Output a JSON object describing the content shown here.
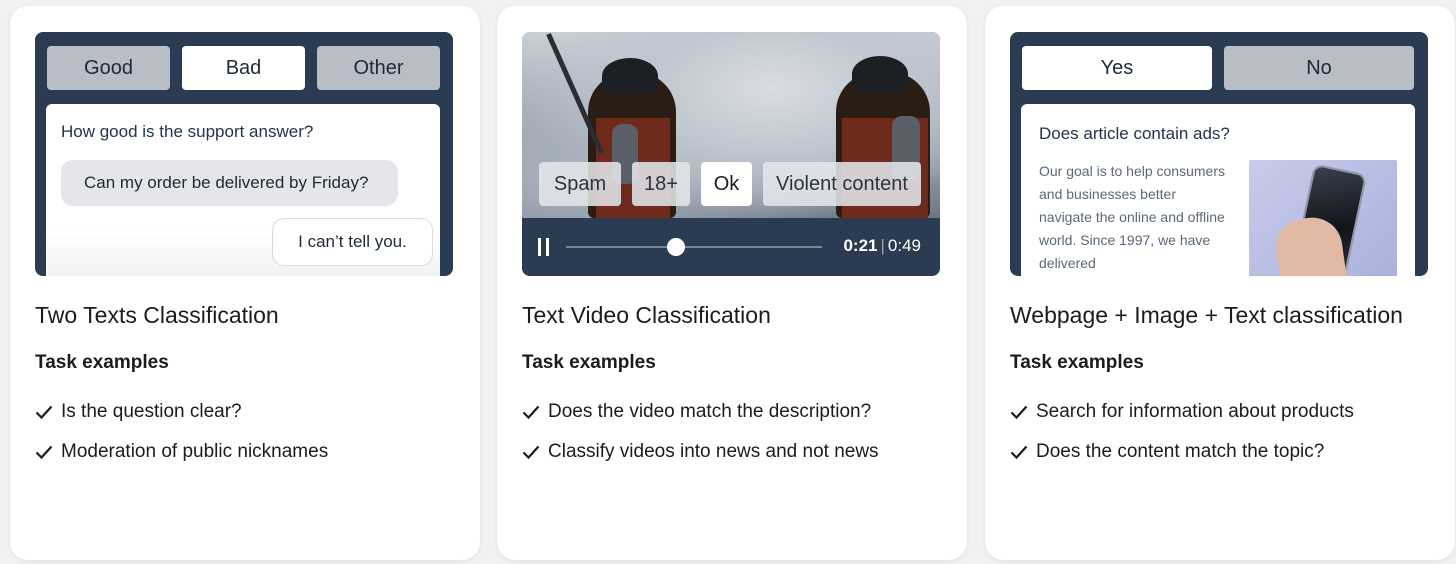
{
  "cards": [
    {
      "title": "Two Texts Classification",
      "task_heading": "Task examples",
      "tasks": [
        "Is the question clear?",
        "Moderation of public nicknames"
      ],
      "preview": {
        "tabs": [
          "Good",
          "Bad",
          "Other"
        ],
        "active_tab": "Bad",
        "question": "How good is the support answer?",
        "message_left": "Can my order be delivered by Friday?",
        "message_right": "I can’t tell you."
      }
    },
    {
      "title": "Text Video Classification",
      "task_heading": "Task examples",
      "tasks": [
        "Does the video match the description?",
        "Classify videos into news and not news"
      ],
      "preview": {
        "tags": [
          "Spam",
          "18+",
          "Ok",
          "Violent content"
        ],
        "active_tag": "Ok",
        "time_current": "0:21",
        "time_separator": "|",
        "time_total": "0:49",
        "progress_fraction": 0.43
      }
    },
    {
      "title": "Webpage + Image + Text classification",
      "task_heading": "Task examples",
      "tasks": [
        "Search for information about products",
        "Does the content match the topic?"
      ],
      "preview": {
        "tabs": [
          "Yes",
          "No"
        ],
        "active_tab": "Yes",
        "question": "Does article contain ads?",
        "body": "Our goal is to help consumers and businesses better navigate the online and offline world. Since 1997, we have delivered"
      }
    }
  ],
  "icons": {
    "check": "check-icon",
    "pause": "pause-icon"
  },
  "colors": {
    "preview_bg": "#2b3c52",
    "tab_inactive": "#b8bdc6",
    "tab_active": "#ffffff"
  }
}
